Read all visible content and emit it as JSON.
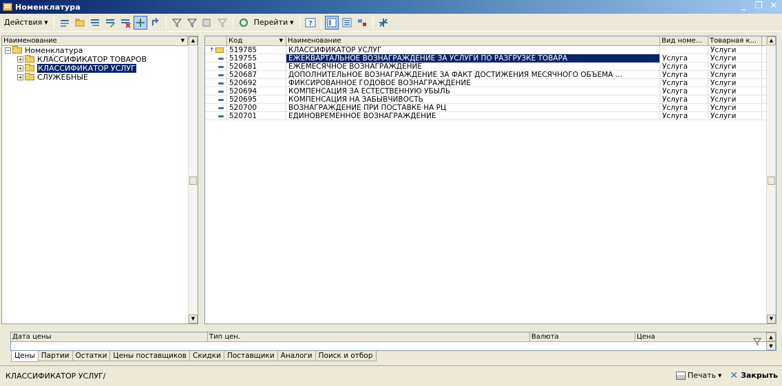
{
  "window": {
    "title": "Номенклатура"
  },
  "toolbar": {
    "actions_label": "Действия",
    "goto_label": "Перейти"
  },
  "tree": {
    "header": "Наименование",
    "root": "Номенклатура",
    "items": [
      "КЛАССИФИКАТОР ТОВАРОВ",
      "КЛАССИФИКАТОР УСЛУГ",
      "СЛУЖЕБНЫЕ"
    ]
  },
  "grid": {
    "headers": {
      "code": "Код",
      "name": "Наименование",
      "kind": "Вид номе...",
      "category": "Товарная к..."
    },
    "rows": [
      {
        "code": "519785",
        "name": "КЛАССИФИКАТОР УСЛУГ",
        "kind": "",
        "category": "Услуги"
      },
      {
        "code": "519755",
        "name": "ЕЖЕКВАРТАЛЬНОЕ ВОЗНАГРАЖДЕНИЕ ЗА УСЛУГИ ПО РАЗГРУЗКЕ ТОВАРА",
        "kind": "Услуга",
        "category": "Услуги"
      },
      {
        "code": "520681",
        "name": "ЕЖЕМЕСЯЧНОЕ ВОЗНАГРАЖДЕНИЕ",
        "kind": "Услуга",
        "category": "Услуги"
      },
      {
        "code": "520687",
        "name": "ДОПОЛНИТЕЛЬНОЕ ВОЗНАГРАЖДЕНИЕ ЗА ФАКТ ДОСТИЖЕНИЯ МЕСЯЧНОГО ОБЪЕМА ...",
        "kind": "Услуга",
        "category": "Услуги"
      },
      {
        "code": "520692",
        "name": "ФИКСИРОВАННОЕ ГОДОВОЕ ВОЗНАГРАЖДЕНИЕ",
        "kind": "Услуга",
        "category": "Услуги"
      },
      {
        "code": "520694",
        "name": "КОМПЕНСАЦИЯ ЗА ЕСТЕСТВЕННУЮ УБЫЛЬ",
        "kind": "Услуга",
        "category": "Услуги"
      },
      {
        "code": "520695",
        "name": "КОМПЕНСАЦИЯ НА ЗАБЫВЧИВОСТЬ",
        "kind": "Услуга",
        "category": "Услуги"
      },
      {
        "code": "520700",
        "name": "ВОЗНАГРАЖДЕНИЕ ПРИ ПОСТАВКЕ НА РЦ",
        "kind": "Услуга",
        "category": "Услуги"
      },
      {
        "code": "520701",
        "name": "ЕДИНОВРЕМЕННОЕ ВОЗНАГРАЖДЕНИЕ",
        "kind": "Услуга",
        "category": "Услуги"
      }
    ]
  },
  "prices": {
    "headers": {
      "date": "Дата цены",
      "type": "Тип цен.",
      "currency": "Валюта",
      "price": "Цена"
    }
  },
  "tabs": [
    "Цены",
    "Партии",
    "Остатки",
    "Цены поставщиков",
    "Скидки",
    "Поставщики",
    "Аналоги",
    "Поиск и отбор"
  ],
  "status": {
    "path": "КЛАССИФИКАТОР УСЛУГ/",
    "print_label": "Печать",
    "close_label": "Закрыть"
  },
  "colors": {
    "selection": "#0a246a",
    "title_start": "#0a246a",
    "title_end": "#a6caf0",
    "panel_bg": "#ece9d8"
  }
}
